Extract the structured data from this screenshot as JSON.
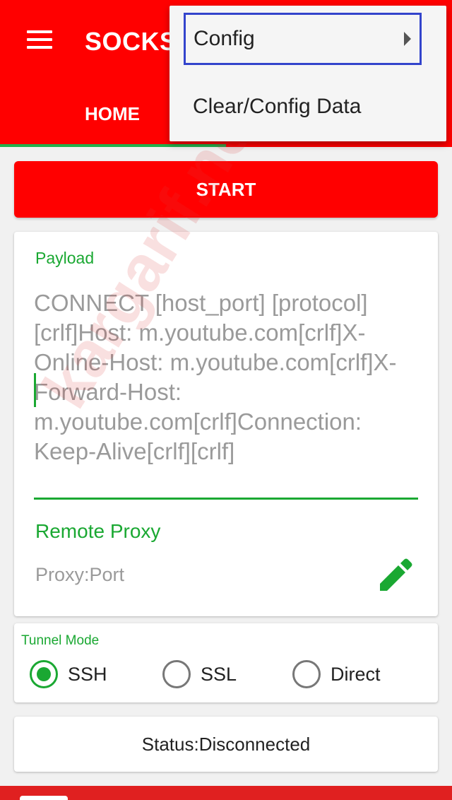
{
  "app_bar": {
    "title": "SOCKS",
    "tab_home": "HOME",
    "menu_icon": "hamburger-menu-icon"
  },
  "overflow_menu": {
    "items": [
      {
        "label": "Config",
        "has_submenu": true,
        "focused": true
      },
      {
        "label": "Clear/Config Data"
      }
    ]
  },
  "start_button": {
    "label": "START"
  },
  "payload": {
    "label": "Payload",
    "value": "CONNECT [host_port] [protocol][crlf]Host: m.youtube.com[crlf]X-Online-Host: m.youtube.com[crlf]X-Forward-Host: m.youtube.com[crlf]Connection: Keep-Alive[crlf][crlf]"
  },
  "remote_proxy": {
    "label": "Remote Proxy",
    "placeholder": "Proxy:Port",
    "edit_icon": "pencil-icon"
  },
  "tunnel_mode": {
    "label": "Tunnel Mode",
    "options": [
      {
        "label": "SSH",
        "selected": true
      },
      {
        "label": "SSL",
        "selected": false
      },
      {
        "label": "Direct",
        "selected": false
      }
    ]
  },
  "status": {
    "text": "Status:Disconnected"
  },
  "watermark": {
    "text": "kargarif.net"
  },
  "colors": {
    "primary_red": "#ff0000",
    "accent_green": "#1aa832",
    "menu_focus_border": "#3344cc"
  }
}
